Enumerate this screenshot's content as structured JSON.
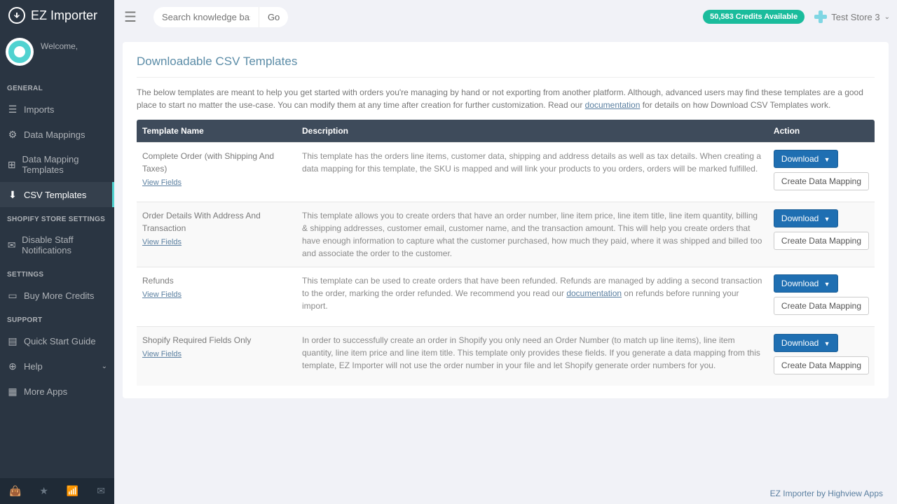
{
  "app_name": "EZ Importer",
  "welcome": {
    "label": "Welcome,",
    "name": "       "
  },
  "sections": {
    "general": "GENERAL",
    "shopify": "SHOPIFY STORE SETTINGS",
    "settings": "SETTINGS",
    "support": "SUPPORT"
  },
  "nav": {
    "imports": "Imports",
    "data_mappings": "Data Mappings",
    "data_mapping_templates": "Data Mapping Templates",
    "csv_templates": "CSV Templates",
    "disable_staff": "Disable Staff Notifications",
    "buy_more": "Buy More Credits",
    "quick_start": "Quick Start Guide",
    "help": "Help",
    "more_apps": "More Apps"
  },
  "search": {
    "placeholder": "Search knowledge base...",
    "go": "Go"
  },
  "credits": "50,583 Credits Available",
  "store": "Test Store 3",
  "page_title": "Downloadable CSV Templates",
  "intro_pre": "The below templates are meant to help you get started with orders you're managing by hand or not exporting from another platform. Although, advanced users may find these templates are a good place to start no matter the use-case. You can modify them at any time after creation for further customization. Read our ",
  "intro_link": "documentation",
  "intro_post": " for details on how Download CSV Templates work.",
  "columns": {
    "name": "Template Name",
    "desc": "Description",
    "action": "Action"
  },
  "view_fields": "View Fields",
  "download": "Download",
  "create_mapping": "Create Data Mapping",
  "templates": [
    {
      "name": "Complete Order (with Shipping And Taxes)",
      "desc": "This template has the orders line items, customer data, shipping and address details as well as tax details. When creating a data mapping for this template, the SKU is mapped and will link your products to you orders, orders will be marked fulfilled."
    },
    {
      "name": "Order Details With Address And Transaction",
      "desc": "This template allows you to create orders that have an order number, line item price, line item title, line item quantity, billing & shipping addresses, customer email, customer name, and the transaction amount. This will help you create orders that have enough information to capture what the customer purchased, how much they paid, where it was shipped and billed too and associate the order to the customer."
    },
    {
      "name": "Refunds",
      "desc_pre": "This template can be used to create orders that have been refunded. Refunds are managed by adding a second transaction to the order, marking the order refunded. We recommend you read our ",
      "desc_link": "documentation",
      "desc_post": " on refunds before running your import."
    },
    {
      "name": "Shopify Required Fields Only",
      "desc": "In order to successfully create an order in Shopify you only need an Order Number (to match up line items), line item quantity, line item price and line item title. This template only provides these fields. If you generate a data mapping from this template, EZ Importer will not use the order number in your file and let Shopify generate order numbers for you."
    }
  ],
  "footer": "EZ Importer by Highview Apps"
}
